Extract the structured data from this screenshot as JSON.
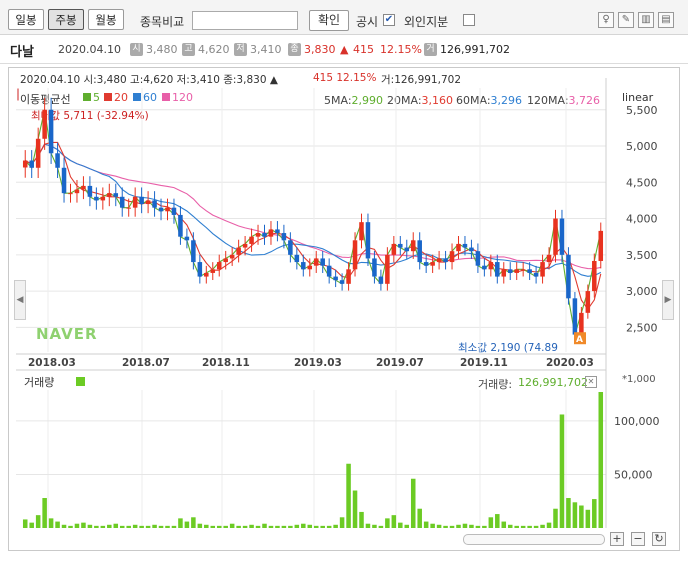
{
  "toolbar": {
    "tabs": [
      {
        "label": "일봉",
        "active": false
      },
      {
        "label": "주봉",
        "active": true
      },
      {
        "label": "월봉",
        "active": false
      }
    ],
    "compare_label": "종목비교",
    "compare_value": "",
    "confirm_label": "확인",
    "disclosure_label": "공시",
    "disclosure_checked": true,
    "foreign_label": "외인지분",
    "foreign_checked": false
  },
  "info": {
    "name": "다날",
    "date": "2020.04.10",
    "open_icon": "시",
    "open": "3,480",
    "high_icon": "고",
    "high": "4,620",
    "low_icon": "저",
    "low": "3,410",
    "close_icon": "종",
    "close": "3,830",
    "change_arrow": "▲",
    "change": "415",
    "change_pct": "12.15%",
    "volume_icon": "거",
    "volume": "126,991,702"
  },
  "chart_header": {
    "ohlc": "2020.04.10  시:3,480  고:4,620  저:3,410  종:3,830 ▲",
    "change": "415  12.15%",
    "volume": "거:126,991,702"
  },
  "ma_legend": {
    "title": "이동평균선",
    "items": [
      {
        "label": "5",
        "color": "#5fae2e"
      },
      {
        "label": "20",
        "color": "#e03a2f"
      },
      {
        "label": "60",
        "color": "#2f7fd1"
      },
      {
        "label": "120",
        "color": "#e85fa8"
      }
    ]
  },
  "ma_values": [
    {
      "label": "5MA:",
      "value": "2,990",
      "color": "#5fae2e"
    },
    {
      "label": "20MA:",
      "value": "3,160",
      "color": "#e03a2f"
    },
    {
      "label": "60MA:",
      "value": "3,296",
      "color": "#2f7fd1"
    },
    {
      "label": "120MA:",
      "value": "3,726",
      "color": "#e85fa8"
    }
  ],
  "scale_label": "linear",
  "max_annotation": "최대값 5,711 (-32.94%)",
  "min_annotation": "최소값 2,190 (74.89",
  "watermark": "NAVER",
  "volume_panel": {
    "title": "거래량",
    "value_label": "거래량:",
    "value": "126,991,702",
    "unit": "*1,000"
  },
  "colors": {
    "up": "#e8321f",
    "down": "#1a66c9",
    "volume": "#6ccb24",
    "ma5": "#5fae2e",
    "ma20": "#e03a2f",
    "ma60": "#2f7fd1",
    "ma120": "#e85fa8"
  },
  "chart_data": {
    "type": "candlestick",
    "title": "다날",
    "interval": "weekly",
    "x_ticks": [
      "2018.03",
      "2018.07",
      "2018.11",
      "2019.03",
      "2019.07",
      "2019.11",
      "2020.03"
    ],
    "price_ticks": [
      2500,
      3000,
      3500,
      4000,
      4500,
      5000,
      5500
    ],
    "price_range": [
      2160,
      5800
    ],
    "volume_ticks": [
      50000,
      100000
    ],
    "volume_range": [
      0,
      126992
    ],
    "volume_unit": "*1,000",
    "grid": true,
    "close": [
      4800,
      4700,
      5100,
      5500,
      4900,
      4700,
      4350,
      4350,
      4400,
      4450,
      4300,
      4250,
      4300,
      4350,
      4300,
      4150,
      4150,
      4300,
      4200,
      4250,
      4150,
      4100,
      4150,
      4050,
      3750,
      3700,
      3400,
      3200,
      3250,
      3300,
      3400,
      3450,
      3500,
      3600,
      3650,
      3750,
      3800,
      3750,
      3850,
      3800,
      3700,
      3500,
      3400,
      3300,
      3350,
      3450,
      3350,
      3200,
      3150,
      3100,
      3300,
      3700,
      3950,
      3450,
      3200,
      3100,
      3500,
      3650,
      3600,
      3550,
      3700,
      3400,
      3350,
      3400,
      3450,
      3400,
      3550,
      3650,
      3600,
      3550,
      3350,
      3300,
      3400,
      3200,
      3300,
      3250,
      3300,
      3300,
      3250,
      3200,
      3400,
      3500,
      4000,
      3500,
      2900,
      2400,
      2700,
      3000,
      3415,
      3830
    ],
    "volume": [
      8000,
      5000,
      12000,
      28000,
      9000,
      6000,
      3000,
      2000,
      4000,
      5000,
      3000,
      2000,
      2000,
      3000,
      4000,
      2000,
      2000,
      3000,
      2000,
      2000,
      3000,
      2000,
      2000,
      2000,
      9000,
      6000,
      10000,
      4000,
      3000,
      2000,
      2000,
      2000,
      4000,
      2000,
      2000,
      3000,
      2000,
      4000,
      2000,
      2000,
      2000,
      2000,
      3000,
      4000,
      3000,
      2000,
      2000,
      2000,
      3000,
      10000,
      60000,
      35000,
      15000,
      4000,
      3000,
      2000,
      9000,
      12000,
      5000,
      3000,
      46000,
      18000,
      6000,
      4000,
      3000,
      2000,
      2000,
      3000,
      4000,
      3000,
      2000,
      2000,
      10000,
      13000,
      6000,
      3000,
      2000,
      2000,
      2000,
      2000,
      3000,
      5000,
      18000,
      106000,
      28000,
      24000,
      21000,
      17000,
      27000,
      126992
    ],
    "annotations": {
      "max": {
        "label": "최대값 5,711 (-32.94%)",
        "value": 5711
      },
      "min": {
        "label": "최소값 2,190 (74.89",
        "value": 2190
      }
    },
    "series_ma": [
      "5",
      "20",
      "60",
      "120"
    ]
  }
}
